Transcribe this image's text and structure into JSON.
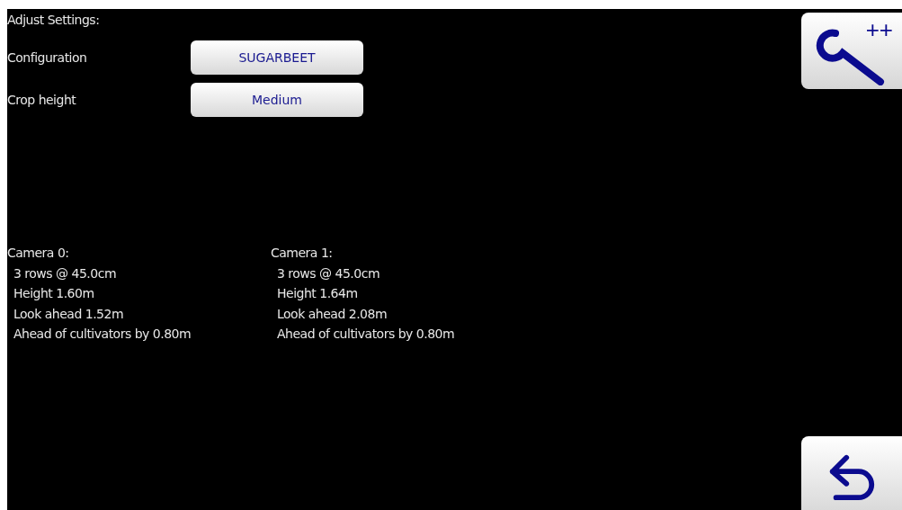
{
  "title": "Adjust Settings:",
  "settings": [
    {
      "label": "Configuration",
      "value": "SUGARBEET"
    },
    {
      "label": "Crop height",
      "value": "Medium"
    }
  ],
  "cameras": [
    {
      "title": "Camera 0:",
      "lines": [
        "3 rows @ 45.0cm",
        "Height 1.60m",
        "Look ahead 1.52m",
        "Ahead of cultivators by 0.80m"
      ]
    },
    {
      "title": "Camera 1:",
      "lines": [
        "3 rows @ 45.0cm",
        "Height 1.64m",
        "Look ahead 2.08m",
        "Ahead of cultivators by 0.80m"
      ]
    }
  ],
  "advanced_button": {
    "label": "++"
  }
}
